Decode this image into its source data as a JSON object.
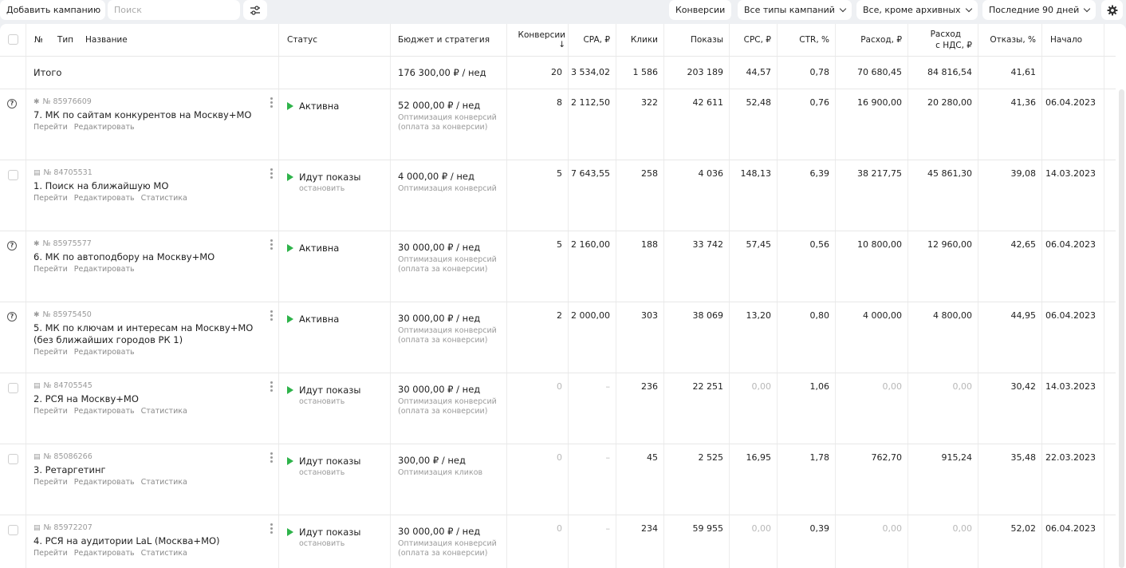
{
  "toolbar": {
    "add_campaign": "Добавить кампанию",
    "search_placeholder": "Поиск",
    "conversions": "Конверсии",
    "campaign_types": "Все типы кампаний",
    "archive_filter": "Все, кроме архивных",
    "period": "Последние 90 дней"
  },
  "columns": {
    "number": "№",
    "type": "Тип",
    "name": "Название",
    "status": "Статус",
    "budget": "Бюджет и стратегия",
    "conversions": "Конверсии ↓",
    "cpa": "CPA, ₽",
    "clicks": "Клики",
    "impressions": "Показы",
    "cpc": "CPC, ₽",
    "ctr": "CTR, %",
    "spend": "Расход, ₽",
    "spend_vat_1": "Расход",
    "spend_vat_2": "с НДС, ₽",
    "bounce": "Отказы, %",
    "start": "Начало"
  },
  "total": {
    "label": "Итого",
    "budget": "176 300,00 ₽ / нед",
    "conversions": "20",
    "cpa": "3 534,02",
    "clicks": "1 586",
    "impressions": "203 189",
    "cpc": "44,57",
    "ctr": "0,78",
    "spend": "70 680,45",
    "spend_vat": "84 816,54",
    "bounce": "41,61"
  },
  "links": {
    "go": "Перейти",
    "edit": "Редактировать",
    "stats": "Статистика",
    "stop": "остановить"
  },
  "rows": [
    {
      "id": "№ 85976609",
      "type_icon": "master-campaign-icon",
      "name": "7. МК по сайтам конкурентов на Москву+МО",
      "status": "Активна",
      "status_sub": "",
      "budget": "52 000,00 ₽ / нед",
      "strategy": "Оптимизация конверсий (оплата за конверсии)",
      "conversions": "8",
      "cpa": "2 112,50",
      "clicks": "322",
      "impressions": "42 611",
      "cpc": "52,48",
      "ctr": "0,76",
      "spend": "16 900,00",
      "spend_vat": "20 280,00",
      "bounce": "41,36",
      "start": "06.04.2023"
    },
    {
      "id": "№ 84705531",
      "type_icon": "text-campaign-icon",
      "name": "1. Поиск на ближайшую МО",
      "status": "Идут показы",
      "status_sub": "остановить",
      "budget": "4 000,00 ₽ / нед",
      "strategy": "Оптимизация конверсий",
      "conversions": "5",
      "cpa": "7 643,55",
      "clicks": "258",
      "impressions": "4 036",
      "cpc": "148,13",
      "ctr": "6,39",
      "spend": "38 217,75",
      "spend_vat": "45 861,30",
      "bounce": "39,08",
      "start": "14.03.2023"
    },
    {
      "id": "№ 85975577",
      "type_icon": "master-campaign-icon",
      "name": "6. МК по автоподбору на Москву+МО",
      "status": "Активна",
      "status_sub": "",
      "budget": "30 000,00 ₽ / нед",
      "strategy": "Оптимизация конверсий (оплата за конверсии)",
      "conversions": "5",
      "cpa": "2 160,00",
      "clicks": "188",
      "impressions": "33 742",
      "cpc": "57,45",
      "ctr": "0,56",
      "spend": "10 800,00",
      "spend_vat": "12 960,00",
      "bounce": "42,65",
      "start": "06.04.2023"
    },
    {
      "id": "№ 85975450",
      "type_icon": "master-campaign-icon",
      "name": "5. МК по ключам и интересам на Москву+МО (без ближайших городов РК 1)",
      "status": "Активна",
      "status_sub": "",
      "budget": "30 000,00 ₽ / нед",
      "strategy": "Оптимизация конверсий (оплата за конверсии)",
      "conversions": "2",
      "cpa": "2 000,00",
      "clicks": "303",
      "impressions": "38 069",
      "cpc": "13,20",
      "ctr": "0,80",
      "spend": "4 000,00",
      "spend_vat": "4 800,00",
      "bounce": "44,95",
      "start": "06.04.2023"
    },
    {
      "id": "№ 84705545",
      "type_icon": "text-campaign-icon",
      "name": "2. РСЯ на Москву+МО",
      "status": "Идут показы",
      "status_sub": "остановить",
      "budget": "30 000,00 ₽ / нед",
      "strategy": "Оптимизация конверсий (оплата за конверсии)",
      "conversions": "0",
      "cpa": "–",
      "clicks": "236",
      "impressions": "22 251",
      "cpc": "0,00",
      "ctr": "1,06",
      "spend": "0,00",
      "spend_vat": "0,00",
      "bounce": "30,42",
      "start": "14.03.2023"
    },
    {
      "id": "№ 85086266",
      "type_icon": "text-campaign-icon",
      "name": "3. Ретаргетинг",
      "status": "Идут показы",
      "status_sub": "остановить",
      "budget": "300,00 ₽ / нед",
      "strategy": "Оптимизация кликов",
      "conversions": "0",
      "cpa": "–",
      "clicks": "45",
      "impressions": "2 525",
      "cpc": "16,95",
      "ctr": "1,78",
      "spend": "762,70",
      "spend_vat": "915,24",
      "bounce": "35,48",
      "start": "22.03.2023"
    },
    {
      "id": "№ 85972207",
      "type_icon": "text-campaign-icon",
      "name": "4. РСЯ на аудитории LaL (Москва+МО)",
      "status": "Идут показы",
      "status_sub": "остановить",
      "budget": "30 000,00 ₽ / нед",
      "strategy": "Оптимизация конверсий (оплата за конверсии)",
      "conversions": "0",
      "cpa": "–",
      "clicks": "234",
      "impressions": "59 955",
      "cpc": "0,00",
      "ctr": "0,39",
      "spend": "0,00",
      "spend_vat": "0,00",
      "bounce": "52,02",
      "start": "06.04.2023"
    }
  ]
}
